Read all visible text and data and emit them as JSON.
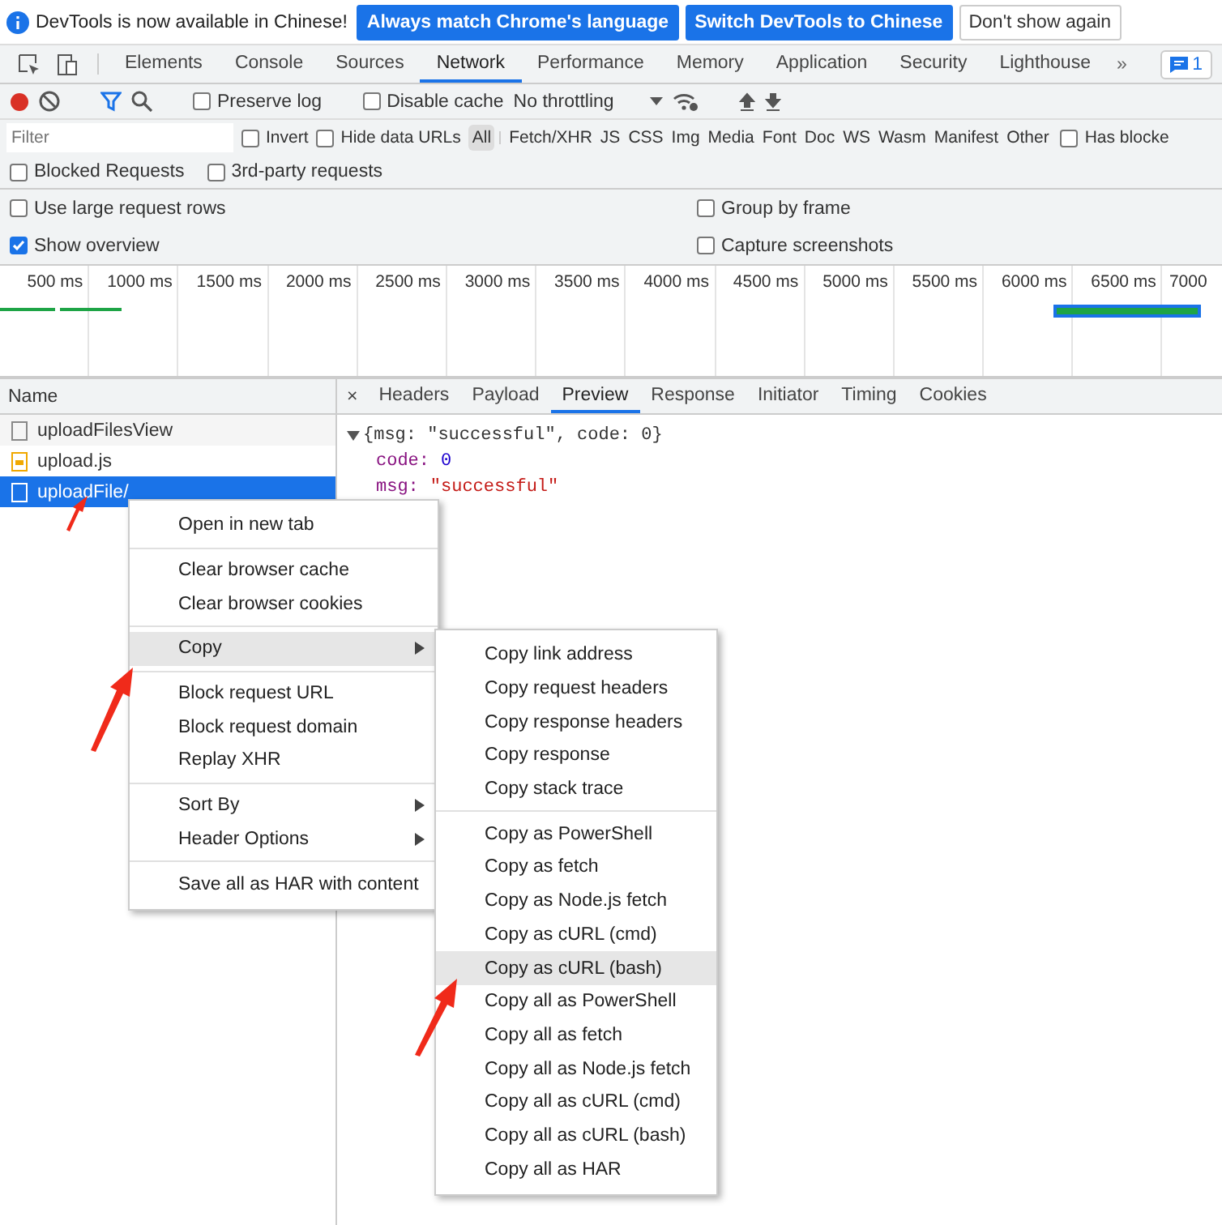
{
  "infobar": {
    "message": "DevTools is now available in Chinese!",
    "buttons": [
      {
        "label": "Always match Chrome's language",
        "kind": "primary"
      },
      {
        "label": "Switch DevTools to Chinese",
        "kind": "primary"
      },
      {
        "label": "Don't show again",
        "kind": "plain"
      }
    ]
  },
  "main_tabs": [
    {
      "label": "Elements",
      "selected": false
    },
    {
      "label": "Console",
      "selected": false
    },
    {
      "label": "Sources",
      "selected": false
    },
    {
      "label": "Network",
      "selected": true
    },
    {
      "label": "Performance",
      "selected": false
    },
    {
      "label": "Memory",
      "selected": false
    },
    {
      "label": "Application",
      "selected": false
    },
    {
      "label": "Security",
      "selected": false
    },
    {
      "label": "Lighthouse",
      "selected": false
    }
  ],
  "more_tabs": "»",
  "issues_badge": "1",
  "toolbar": {
    "recording": true,
    "preserve_log": {
      "label": "Preserve log",
      "checked": false
    },
    "disable_cache": {
      "label": "Disable cache",
      "checked": false
    },
    "throttling": "No throttling"
  },
  "filter": {
    "placeholder": "Filter",
    "invert": {
      "label": "Invert",
      "checked": false
    },
    "hide_data_urls": {
      "label": "Hide data URLs",
      "checked": false
    },
    "types": [
      {
        "label": "All",
        "selected": true
      },
      {
        "label": "Fetch/XHR",
        "selected": false
      },
      {
        "label": "JS",
        "selected": false
      },
      {
        "label": "CSS",
        "selected": false
      },
      {
        "label": "Img",
        "selected": false
      },
      {
        "label": "Media",
        "selected": false
      },
      {
        "label": "Font",
        "selected": false
      },
      {
        "label": "Doc",
        "selected": false
      },
      {
        "label": "WS",
        "selected": false
      },
      {
        "label": "Wasm",
        "selected": false
      },
      {
        "label": "Manifest",
        "selected": false
      },
      {
        "label": "Other",
        "selected": false
      }
    ],
    "has_blocked": {
      "label": "Has blocke",
      "checked": false
    },
    "blocked_requests": {
      "label": "Blocked Requests",
      "checked": false
    },
    "third_party": {
      "label": "3rd-party requests",
      "checked": false
    }
  },
  "settings": [
    {
      "label": "Use large request rows",
      "checked": false
    },
    {
      "label": "Group by frame",
      "checked": false
    },
    {
      "label": "Show overview",
      "checked": true
    },
    {
      "label": "Capture screenshots",
      "checked": false
    }
  ],
  "overview": {
    "ticks": [
      "500 ms",
      "1000 ms",
      "1500 ms",
      "2000 ms",
      "2500 ms",
      "3000 ms",
      "3500 ms",
      "4000 ms",
      "4500 ms",
      "5000 ms",
      "5500 ms",
      "6000 ms",
      "6500 ms",
      "7000"
    ]
  },
  "requests": {
    "header": "Name",
    "rows": [
      {
        "name": "uploadFilesView",
        "kind": "document",
        "selected": false
      },
      {
        "name": "upload.js",
        "kind": "script",
        "selected": false
      },
      {
        "name": "uploadFile/",
        "kind": "document",
        "selected": true
      }
    ]
  },
  "detail": {
    "close": "×",
    "tabs": [
      {
        "label": "Headers",
        "selected": false
      },
      {
        "label": "Payload",
        "selected": false
      },
      {
        "label": "Preview",
        "selected": true
      },
      {
        "label": "Response",
        "selected": false
      },
      {
        "label": "Initiator",
        "selected": false
      },
      {
        "label": "Timing",
        "selected": false
      },
      {
        "label": "Cookies",
        "selected": false
      }
    ],
    "preview": {
      "expanded": true,
      "summary": "{msg: \"successful\", code: 0}",
      "properties": [
        {
          "key": "code:",
          "value": "0",
          "kind": "number"
        },
        {
          "key": "msg:",
          "value": "\"successful\"",
          "kind": "string"
        }
      ]
    }
  },
  "context_menu": {
    "groups": [
      [
        {
          "label": "Open in new tab",
          "submenu": false,
          "highlighted": false
        }
      ],
      [
        {
          "label": "Clear browser cache",
          "submenu": false,
          "highlighted": false
        },
        {
          "label": "Clear browser cookies",
          "submenu": false,
          "highlighted": false
        }
      ],
      [
        {
          "label": "Copy",
          "submenu": true,
          "highlighted": true
        }
      ],
      [
        {
          "label": "Block request URL",
          "submenu": false,
          "highlighted": false
        },
        {
          "label": "Block request domain",
          "submenu": false,
          "highlighted": false
        },
        {
          "label": "Replay XHR",
          "submenu": false,
          "highlighted": false
        }
      ],
      [
        {
          "label": "Sort By",
          "submenu": true,
          "highlighted": false
        },
        {
          "label": "Header Options",
          "submenu": true,
          "highlighted": false
        }
      ],
      [
        {
          "label": "Save all as HAR with content",
          "submenu": false,
          "highlighted": false
        }
      ]
    ]
  },
  "copy_submenu": {
    "groups": [
      [
        {
          "label": "Copy link address",
          "highlighted": false
        },
        {
          "label": "Copy request headers",
          "highlighted": false
        },
        {
          "label": "Copy response headers",
          "highlighted": false
        },
        {
          "label": "Copy response",
          "highlighted": false
        },
        {
          "label": "Copy stack trace",
          "highlighted": false
        }
      ],
      [
        {
          "label": "Copy as PowerShell",
          "highlighted": false
        },
        {
          "label": "Copy as fetch",
          "highlighted": false
        },
        {
          "label": "Copy as Node.js fetch",
          "highlighted": false
        },
        {
          "label": "Copy as cURL (cmd)",
          "highlighted": false
        },
        {
          "label": "Copy as cURL (bash)",
          "highlighted": true
        },
        {
          "label": "Copy all as PowerShell",
          "highlighted": false
        },
        {
          "label": "Copy all as fetch",
          "highlighted": false
        },
        {
          "label": "Copy all as Node.js fetch",
          "highlighted": false
        },
        {
          "label": "Copy all as cURL (cmd)",
          "highlighted": false
        },
        {
          "label": "Copy all as cURL (bash)",
          "highlighted": false
        },
        {
          "label": "Copy all as HAR",
          "highlighted": false
        }
      ]
    ]
  }
}
